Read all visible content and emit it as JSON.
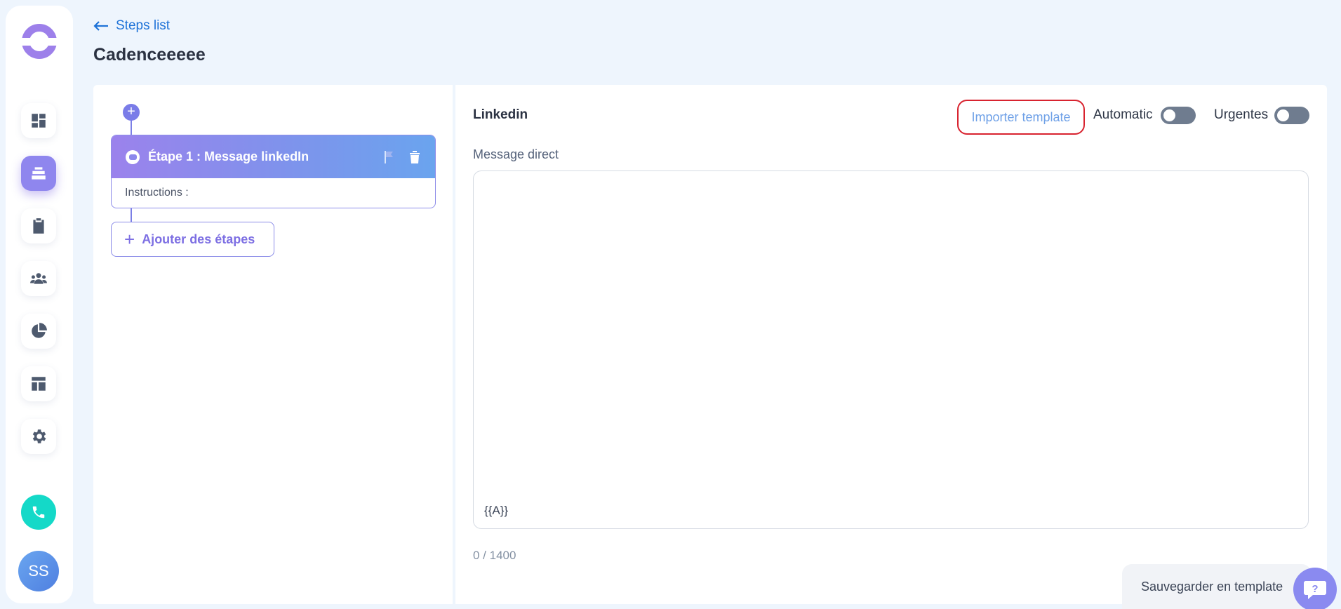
{
  "header": {
    "back_label": "Steps list",
    "page_title": "Cadenceeeee"
  },
  "sidebar": {
    "items": [
      {
        "name": "dashboard",
        "icon": "dashboard-icon",
        "active": false
      },
      {
        "name": "cadences",
        "icon": "stack-icon",
        "active": true
      },
      {
        "name": "tasks",
        "icon": "clipboard-icon",
        "active": false
      },
      {
        "name": "contacts",
        "icon": "people-icon",
        "active": false
      },
      {
        "name": "statistics",
        "icon": "pie-chart-icon",
        "active": false
      },
      {
        "name": "templates",
        "icon": "layout-icon",
        "active": false
      },
      {
        "name": "settings",
        "icon": "gear-icon",
        "active": false
      }
    ],
    "avatar_initials": "SS",
    "accent_color": "#8f86ee",
    "phone_color": "#14d9c8"
  },
  "steps": {
    "items": [
      {
        "title": "Étape 1 : Message linkedIn",
        "instructions_label": "Instructions :"
      }
    ],
    "add_label": "Ajouter des étapes"
  },
  "editor": {
    "section_title": "Linkedin",
    "import_label": "Importer template",
    "automatic_label": "Automatic",
    "urgent_label": "Urgentes",
    "field_label": "Message direct",
    "message_value": "",
    "variable_token": "{{A}}",
    "char_count": "0 / 1400",
    "save_template_label": "Sauvegarder en template"
  }
}
